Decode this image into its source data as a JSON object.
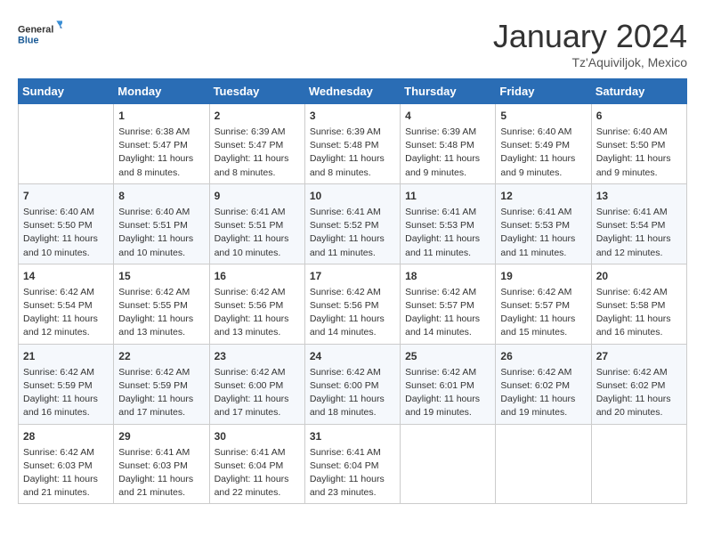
{
  "header": {
    "logo_line1": "General",
    "logo_line2": "Blue",
    "title": "January 2024",
    "subtitle": "Tz'Aquiviljok, Mexico"
  },
  "columns": [
    "Sunday",
    "Monday",
    "Tuesday",
    "Wednesday",
    "Thursday",
    "Friday",
    "Saturday"
  ],
  "weeks": [
    [
      {
        "day": "",
        "info": ""
      },
      {
        "day": "1",
        "info": "Sunrise: 6:38 AM\nSunset: 5:47 PM\nDaylight: 11 hours\nand 8 minutes."
      },
      {
        "day": "2",
        "info": "Sunrise: 6:39 AM\nSunset: 5:47 PM\nDaylight: 11 hours\nand 8 minutes."
      },
      {
        "day": "3",
        "info": "Sunrise: 6:39 AM\nSunset: 5:48 PM\nDaylight: 11 hours\nand 8 minutes."
      },
      {
        "day": "4",
        "info": "Sunrise: 6:39 AM\nSunset: 5:48 PM\nDaylight: 11 hours\nand 9 minutes."
      },
      {
        "day": "5",
        "info": "Sunrise: 6:40 AM\nSunset: 5:49 PM\nDaylight: 11 hours\nand 9 minutes."
      },
      {
        "day": "6",
        "info": "Sunrise: 6:40 AM\nSunset: 5:50 PM\nDaylight: 11 hours\nand 9 minutes."
      }
    ],
    [
      {
        "day": "7",
        "info": "Sunrise: 6:40 AM\nSunset: 5:50 PM\nDaylight: 11 hours\nand 10 minutes."
      },
      {
        "day": "8",
        "info": "Sunrise: 6:40 AM\nSunset: 5:51 PM\nDaylight: 11 hours\nand 10 minutes."
      },
      {
        "day": "9",
        "info": "Sunrise: 6:41 AM\nSunset: 5:51 PM\nDaylight: 11 hours\nand 10 minutes."
      },
      {
        "day": "10",
        "info": "Sunrise: 6:41 AM\nSunset: 5:52 PM\nDaylight: 11 hours\nand 11 minutes."
      },
      {
        "day": "11",
        "info": "Sunrise: 6:41 AM\nSunset: 5:53 PM\nDaylight: 11 hours\nand 11 minutes."
      },
      {
        "day": "12",
        "info": "Sunrise: 6:41 AM\nSunset: 5:53 PM\nDaylight: 11 hours\nand 11 minutes."
      },
      {
        "day": "13",
        "info": "Sunrise: 6:41 AM\nSunset: 5:54 PM\nDaylight: 11 hours\nand 12 minutes."
      }
    ],
    [
      {
        "day": "14",
        "info": "Sunrise: 6:42 AM\nSunset: 5:54 PM\nDaylight: 11 hours\nand 12 minutes."
      },
      {
        "day": "15",
        "info": "Sunrise: 6:42 AM\nSunset: 5:55 PM\nDaylight: 11 hours\nand 13 minutes."
      },
      {
        "day": "16",
        "info": "Sunrise: 6:42 AM\nSunset: 5:56 PM\nDaylight: 11 hours\nand 13 minutes."
      },
      {
        "day": "17",
        "info": "Sunrise: 6:42 AM\nSunset: 5:56 PM\nDaylight: 11 hours\nand 14 minutes."
      },
      {
        "day": "18",
        "info": "Sunrise: 6:42 AM\nSunset: 5:57 PM\nDaylight: 11 hours\nand 14 minutes."
      },
      {
        "day": "19",
        "info": "Sunrise: 6:42 AM\nSunset: 5:57 PM\nDaylight: 11 hours\nand 15 minutes."
      },
      {
        "day": "20",
        "info": "Sunrise: 6:42 AM\nSunset: 5:58 PM\nDaylight: 11 hours\nand 16 minutes."
      }
    ],
    [
      {
        "day": "21",
        "info": "Sunrise: 6:42 AM\nSunset: 5:59 PM\nDaylight: 11 hours\nand 16 minutes."
      },
      {
        "day": "22",
        "info": "Sunrise: 6:42 AM\nSunset: 5:59 PM\nDaylight: 11 hours\nand 17 minutes."
      },
      {
        "day": "23",
        "info": "Sunrise: 6:42 AM\nSunset: 6:00 PM\nDaylight: 11 hours\nand 17 minutes."
      },
      {
        "day": "24",
        "info": "Sunrise: 6:42 AM\nSunset: 6:00 PM\nDaylight: 11 hours\nand 18 minutes."
      },
      {
        "day": "25",
        "info": "Sunrise: 6:42 AM\nSunset: 6:01 PM\nDaylight: 11 hours\nand 19 minutes."
      },
      {
        "day": "26",
        "info": "Sunrise: 6:42 AM\nSunset: 6:02 PM\nDaylight: 11 hours\nand 19 minutes."
      },
      {
        "day": "27",
        "info": "Sunrise: 6:42 AM\nSunset: 6:02 PM\nDaylight: 11 hours\nand 20 minutes."
      }
    ],
    [
      {
        "day": "28",
        "info": "Sunrise: 6:42 AM\nSunset: 6:03 PM\nDaylight: 11 hours\nand 21 minutes."
      },
      {
        "day": "29",
        "info": "Sunrise: 6:41 AM\nSunset: 6:03 PM\nDaylight: 11 hours\nand 21 minutes."
      },
      {
        "day": "30",
        "info": "Sunrise: 6:41 AM\nSunset: 6:04 PM\nDaylight: 11 hours\nand 22 minutes."
      },
      {
        "day": "31",
        "info": "Sunrise: 6:41 AM\nSunset: 6:04 PM\nDaylight: 11 hours\nand 23 minutes."
      },
      {
        "day": "",
        "info": ""
      },
      {
        "day": "",
        "info": ""
      },
      {
        "day": "",
        "info": ""
      }
    ]
  ]
}
